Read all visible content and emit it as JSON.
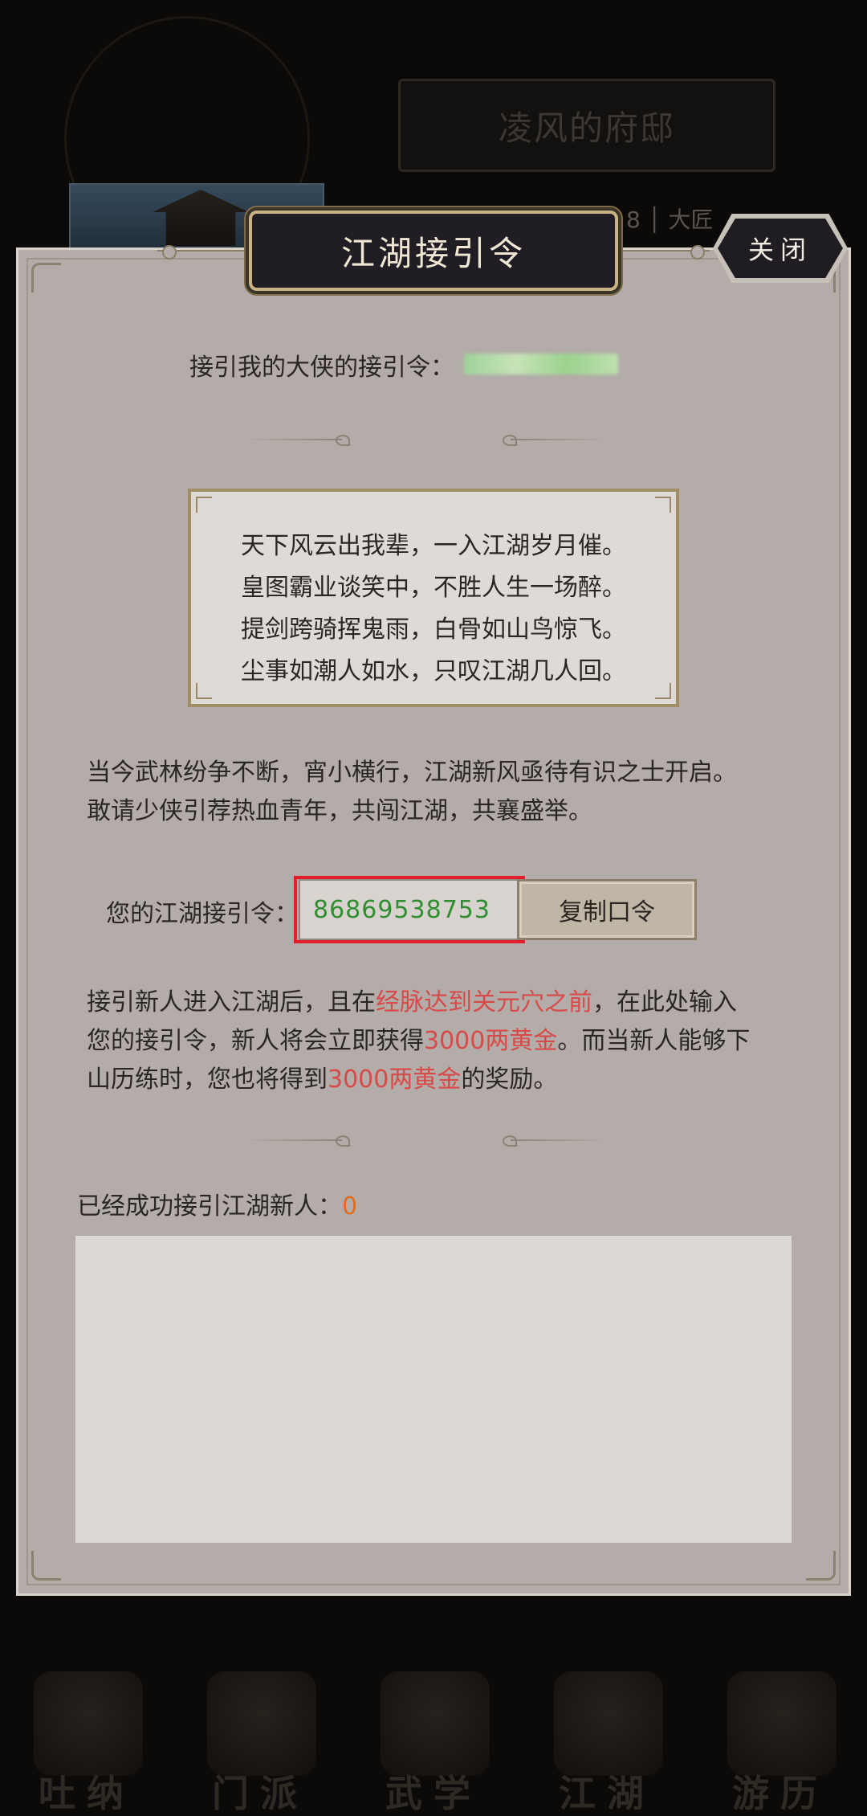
{
  "background": {
    "mansion_title": "凌风的府邸",
    "rank_text": "8 │ 大匠",
    "bottom_nav": [
      {
        "label": "吐纳",
        "icon": "meditation-icon"
      },
      {
        "label": "门派",
        "icon": "sect-flag-icon"
      },
      {
        "label": "武学",
        "icon": "scroll-icon"
      },
      {
        "label": "江湖",
        "icon": "globe-icon"
      },
      {
        "label": "游历",
        "icon": "horse-icon"
      }
    ]
  },
  "dialog": {
    "title": "江湖接引令",
    "close_label": "关闭",
    "inviter_label": "接引我的大侠的接引令：",
    "poem": [
      "天下风云出我辈，一入江湖岁月催。",
      "皇图霸业谈笑中，不胜人生一场醉。",
      "提剑跨骑挥鬼雨，白骨如山鸟惊飞。",
      "尘事如潮人如水，只叹江湖几人回。"
    ],
    "intro_lines": [
      "当今武林纷争不断，宵小横行，江湖新风亟待有识之士开启。",
      "敢请少侠引荐热血青年，共闯江湖，共襄盛举。"
    ],
    "code_label": "您的江湖接引令：",
    "code_value": "86869538753",
    "copy_button": "复制口令",
    "reward": {
      "p1": "接引新人进入江湖后，且在",
      "r1": "经脉达到关元穴之前",
      "p2": "，在此处输入",
      "p3": "您的接引令，新人将会立即获得",
      "r2": "3000两黄金",
      "p4": "。而当新人能够下",
      "p5": "山历练时，您也将得到",
      "r3": "3000两黄金",
      "p6": "的奖励。"
    },
    "success_label": "已经成功接引江湖新人：",
    "success_count": "0"
  },
  "colors": {
    "panel": "#b3aca8",
    "plaque": "#201e24",
    "code_green": "#2f8e2f",
    "highlight_red": "#d84a4a",
    "count_orange": "#e36b1b",
    "annotation_red": "#e31f2d"
  }
}
